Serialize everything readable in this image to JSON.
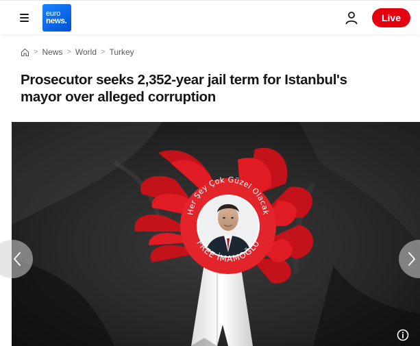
{
  "header": {
    "logo_line1": "euro",
    "logo_line2": "news.",
    "live_label": "Live",
    "menu_icon": "hamburger-menu-icon",
    "user_icon": "user-account-icon"
  },
  "breadcrumb": {
    "home_icon": "home-icon",
    "items": [
      {
        "label": "News"
      },
      {
        "label": "World"
      },
      {
        "label": "Turkey"
      }
    ],
    "separator": ">"
  },
  "article": {
    "headline_line1": "Prosecutor seeks 2,352-year jail term for Istanbul's",
    "headline_line2": "mayor over alleged corruption"
  },
  "hero_image": {
    "rosette_top_text": "Her Şey Çok Güzel Olacak",
    "rosette_bottom_text": "FREE İMAMOĞLU",
    "prev_icon": "chevron-left-icon",
    "next_icon": "chevron-right-icon",
    "info_icon": "info-icon"
  },
  "colors": {
    "live_red": "#e5000f",
    "logo_blue": "#0050d6",
    "rosette_red": "#d7141e",
    "text_dark": "#161616"
  }
}
